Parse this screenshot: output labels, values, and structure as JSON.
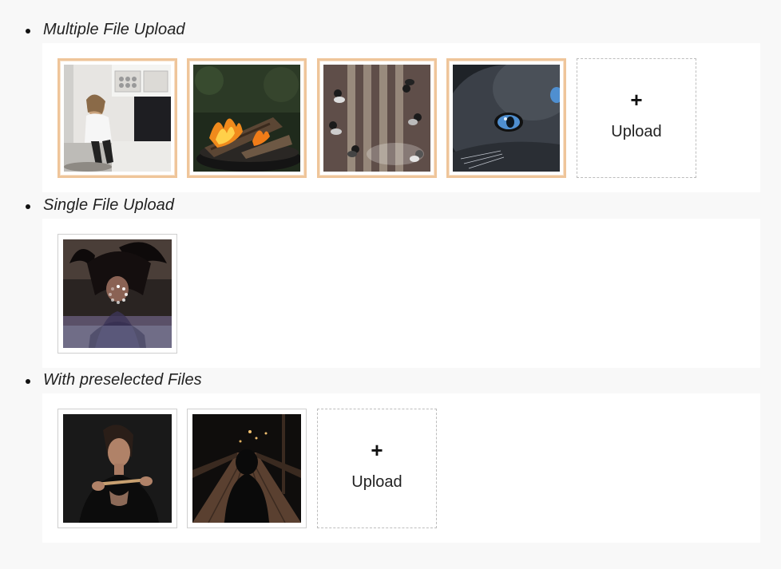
{
  "sections": [
    {
      "title": "Multiple File Upload",
      "files": [
        {
          "icon": "photo-woman-sitting-kitchen"
        },
        {
          "icon": "photo-campfire"
        },
        {
          "icon": "photo-crosswalk-aerial"
        },
        {
          "icon": "photo-cat-eye"
        }
      ],
      "upload": {
        "icon": "plus-icon",
        "symbol": "+",
        "label": "Upload"
      }
    },
    {
      "title": "Single File Upload",
      "files": [
        {
          "icon": "photo-woman-hair-flip",
          "status": "uploading"
        }
      ]
    },
    {
      "title": "With preselected Files",
      "files": [
        {
          "icon": "photo-woman-portrait"
        },
        {
          "icon": "photo-person-on-pier"
        }
      ],
      "upload": {
        "icon": "plus-icon",
        "symbol": "+",
        "label": "Upload"
      }
    }
  ],
  "colors": {
    "page_background": "#f8f8f8",
    "panel_background": "#ffffff",
    "active_border": "#efc59a",
    "plain_border": "#cfcfcf",
    "dashed_border": "#bdbdbd"
  }
}
